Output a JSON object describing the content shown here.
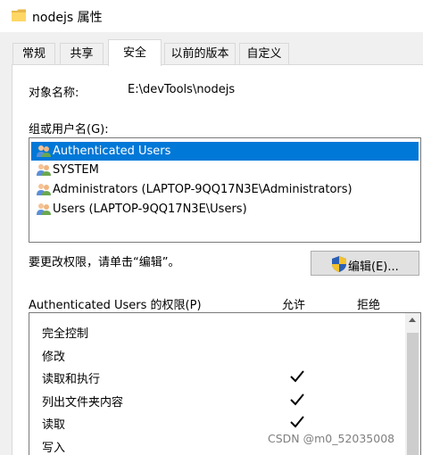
{
  "window": {
    "title": "nodejs 属性"
  },
  "tabs": [
    {
      "label": "常规",
      "active": false
    },
    {
      "label": "共享",
      "active": false
    },
    {
      "label": "安全",
      "active": true
    },
    {
      "label": "以前的版本",
      "active": false
    },
    {
      "label": "自定义",
      "active": false
    }
  ],
  "object": {
    "label": "对象名称:",
    "value": "E:\\devTools\\nodejs"
  },
  "groups": {
    "label": "组或用户名(G):",
    "items": [
      {
        "name": "Authenticated Users",
        "selected": true,
        "icon": "user-group-icon"
      },
      {
        "name": "SYSTEM",
        "selected": false,
        "icon": "user-group-icon"
      },
      {
        "name": "Administrators (LAPTOP-9QQ17N3E\\Administrators)",
        "selected": false,
        "icon": "user-group-icon"
      },
      {
        "name": "Users (LAPTOP-9QQ17N3E\\Users)",
        "selected": false,
        "icon": "user-group-icon"
      }
    ]
  },
  "change_hint": "要更改权限，请单击“编辑”。",
  "edit_button": {
    "label": "编辑(E)...",
    "icon": "uac-shield-icon"
  },
  "permissions": {
    "header": "Authenticated Users 的权限(P)",
    "allow_label": "允许",
    "deny_label": "拒绝",
    "rows": [
      {
        "name": "完全控制",
        "allow": false,
        "deny": false
      },
      {
        "name": "修改",
        "allow": false,
        "deny": false
      },
      {
        "name": "读取和执行",
        "allow": true,
        "deny": false
      },
      {
        "name": "列出文件夹内容",
        "allow": true,
        "deny": false
      },
      {
        "name": "读取",
        "allow": true,
        "deny": false
      },
      {
        "name": "写入",
        "allow": false,
        "deny": false
      }
    ]
  },
  "watermark": "CSDN @m0_52035008",
  "colors": {
    "selection": "#0078d7",
    "window_bg": "#f0f0f0",
    "panel_bg": "#ffffff"
  }
}
